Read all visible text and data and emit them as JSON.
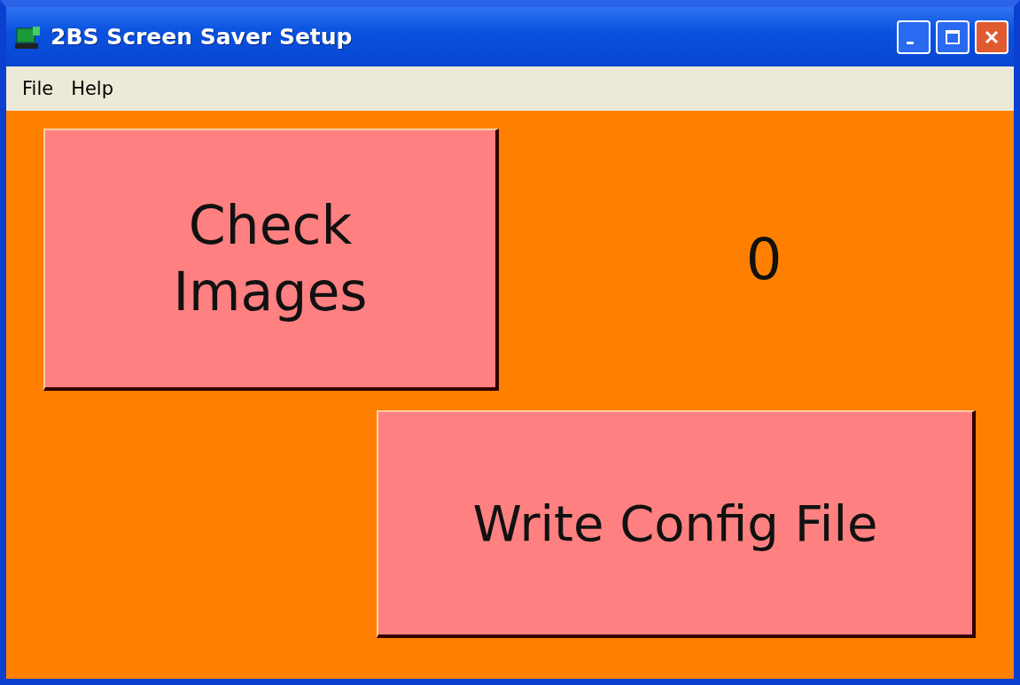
{
  "window": {
    "title": "2BS Screen Saver Setup"
  },
  "menu": [
    "File",
    "Help"
  ],
  "check_button": {
    "label_lines": [
      "Check",
      "Images"
    ]
  },
  "image_count": "0",
  "write_button": {
    "label": "Write Config File"
  }
}
